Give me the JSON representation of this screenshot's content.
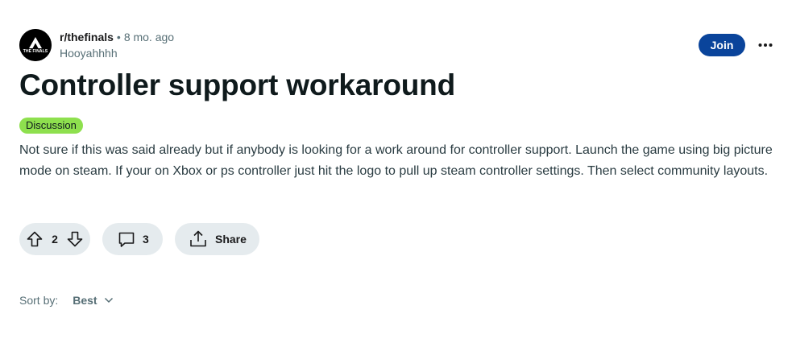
{
  "post": {
    "subreddit": "r/thefinals",
    "separator": "•",
    "time": "8 mo. ago",
    "author": "Hooyahhhh",
    "avatar_text": "THE FINALS",
    "title": "Controller support workaround",
    "flair": "Discussion",
    "body": "Not sure if this was said already but if anybody is looking for a work around for controller support. Launch the game using big picture mode on steam. If your on Xbox or ps controller just hit the logo to pull up steam controller settings. Then select community layouts."
  },
  "header": {
    "join_label": "Join",
    "more_icon": "more-horizontal-icon"
  },
  "actions": {
    "upvote_icon": "arrow-up-icon",
    "vote_count": "2",
    "downvote_icon": "arrow-down-icon",
    "comment_icon": "comment-icon",
    "comment_count": "3",
    "share_icon": "share-icon",
    "share_label": "Share"
  },
  "sort": {
    "label": "Sort by:",
    "value": "Best",
    "icon": "chevron-down-icon"
  },
  "colors": {
    "join_bg": "#0a449b",
    "flair_bg": "#8ee04e",
    "pill_bg": "#e5ebee"
  }
}
